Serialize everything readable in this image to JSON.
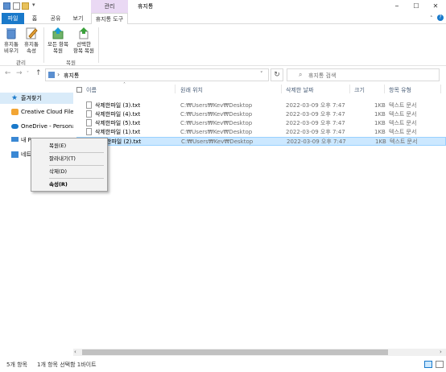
{
  "window": {
    "title": "휴지통",
    "contextual_tab_group": "관리",
    "controls": {
      "minimize": "–",
      "maximize": "☐",
      "close": "✕"
    }
  },
  "ribbon_tabs": {
    "file": "파일",
    "home": "홈",
    "share": "공유",
    "view": "보기",
    "recycle_bin_tools": "휴지통 도구"
  },
  "ribbon": {
    "manage_group": {
      "label": "관리",
      "empty_bin_line1": "휴지통",
      "empty_bin_line2": "비우기",
      "properties_line1": "휴지통",
      "properties_line2": "속성"
    },
    "restore_group": {
      "label": "복원",
      "restore_all_line1": "모든 항목",
      "restore_all_line2": "복원",
      "restore_selected_line1": "선택한",
      "restore_selected_line2": "항목 복원"
    }
  },
  "address_bar": {
    "path_separator": "›",
    "path_item": "휴지통",
    "search_placeholder": "휴지통 검색"
  },
  "nav_pane": {
    "items": [
      {
        "label": "즐겨찾기"
      },
      {
        "label": "Creative Cloud Files"
      },
      {
        "label": "OneDrive - Personal"
      },
      {
        "label": "내 PC"
      },
      {
        "label": "네트"
      }
    ]
  },
  "columns": {
    "name": "이름",
    "original_location": "원래 위치",
    "date_deleted": "삭제한 날짜",
    "size": "크기",
    "item_type": "항목 유형"
  },
  "files": [
    {
      "name": "삭제한파일 (3).txt",
      "location": "C:₩Users₩Kev₩Desktop",
      "date": "2022-03-09 오후 7:47",
      "size": "1KB",
      "type": "텍스트 문서"
    },
    {
      "name": "삭제한파일 (4).txt",
      "location": "C:₩Users₩Kev₩Desktop",
      "date": "2022-03-09 오후 7:47",
      "size": "1KB",
      "type": "텍스트 문서"
    },
    {
      "name": "삭제한파일 (5).txt",
      "location": "C:₩Users₩Kev₩Desktop",
      "date": "2022-03-09 오후 7:47",
      "size": "1KB",
      "type": "텍스트 문서"
    },
    {
      "name": "삭제한파일 (1).txt",
      "location": "C:₩Users₩Kev₩Desktop",
      "date": "2022-03-09 오후 7:47",
      "size": "1KB",
      "type": "텍스트 문서"
    },
    {
      "name": "삭제한파일 (2).txt",
      "location": "C:₩Users₩Kev₩Desktop",
      "date": "2022-03-09 오후 7:47",
      "size": "1KB",
      "type": "텍스트 문서"
    }
  ],
  "context_menu": {
    "restore": "복원(E)",
    "cut": "잘라내기(T)",
    "delete": "삭제(D)",
    "properties": "속성(R)"
  },
  "status_bar": {
    "item_count": "5개 항목",
    "selection": "1개 항목 선택함 1바이트"
  },
  "colors": {
    "accent": "#1979ca",
    "contextual_tab": "#ead9f4",
    "selection_fill": "#cce8ff",
    "selection_border": "#99d1ff"
  }
}
